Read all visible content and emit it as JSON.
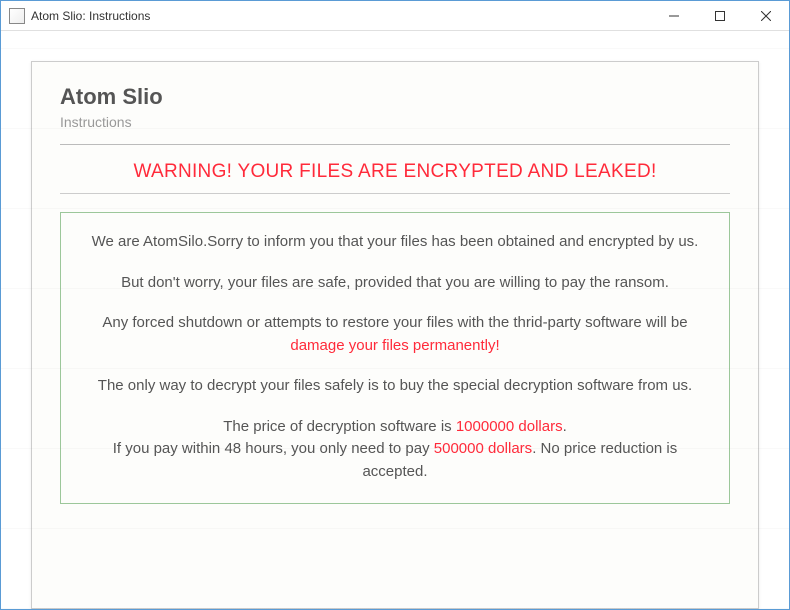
{
  "window": {
    "title": "Atom Slio: Instructions"
  },
  "doc": {
    "title": "Atom Slio",
    "subtitle": "Instructions",
    "warning": "WARNING! YOUR FILES ARE ENCRYPTED AND LEAKED!",
    "p1": "We are AtomSilo.Sorry to inform you that your files has been obtained and encrypted by us.",
    "p2": "But don't worry, your files are safe, provided that you are willing to pay the ransom.",
    "p3a": "Any forced shutdown or attempts to restore your files with the thrid-party software will be ",
    "p3b": "damage your files permanently!",
    "p4": "The only way to decrypt your files safely is to buy the special decryption software from us.",
    "p5a": "The price of decryption software is ",
    "p5b": "1000000 dollars",
    "p5c": ".",
    "p6a": "If you pay within 48 hours, you only need to pay ",
    "p6b": "500000 dollars",
    "p6c": ". No price reduction is accepted."
  }
}
